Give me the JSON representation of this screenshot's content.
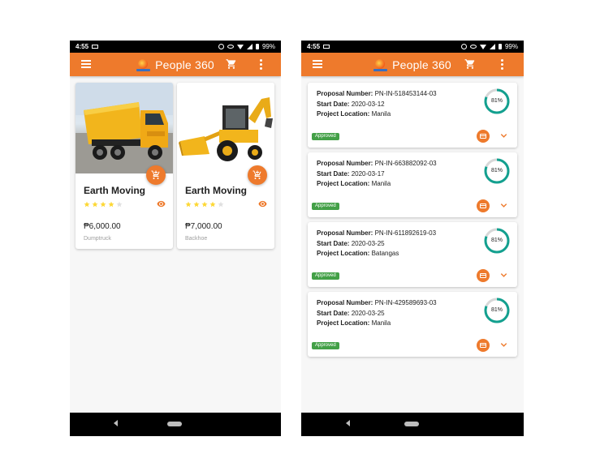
{
  "status_bar": {
    "time": "4:55",
    "battery": "99%"
  },
  "app_bar": {
    "title": "People 360"
  },
  "products": [
    {
      "name": "Earth Moving",
      "price": "₱6,000.00",
      "category": "Dumptruck",
      "rating": 4,
      "image": "dump-truck"
    },
    {
      "name": "Earth Moving",
      "price": "₱7,000.00",
      "category": "Backhoe",
      "rating": 4,
      "image": "backhoe-loader"
    }
  ],
  "proposal_labels": {
    "proposal_number": "Proposal Number:",
    "start_date": "Start Date:",
    "project_location": "Project Location:"
  },
  "proposals": [
    {
      "number": "PN-IN-518453144-03",
      "start_date": "2020-03-12",
      "location": "Manila",
      "status": "Approved",
      "progress": "81%",
      "progress_value": 81
    },
    {
      "number": "PN-IN-663882092-03",
      "start_date": "2020-03-17",
      "location": "Manila",
      "status": "Approved",
      "progress": "81%",
      "progress_value": 81
    },
    {
      "number": "PN-IN-611892619-03",
      "start_date": "2020-03-25",
      "location": "Batangas",
      "status": "Approved",
      "progress": "81%",
      "progress_value": 81
    },
    {
      "number": "PN-IN-429589693-03",
      "start_date": "2020-03-25",
      "location": "Manila",
      "status": "Approved",
      "progress": "81%",
      "progress_value": 81
    }
  ],
  "colors": {
    "primary": "#ee7a2c",
    "progress": "#13a08f",
    "progress_track": "#d8d8d8",
    "approved": "#43a047",
    "star": "#fdd835",
    "star_empty": "#e0e0e0"
  },
  "icons": [
    "menu-icon",
    "cart-icon",
    "more-vert-icon",
    "add-cart-icon",
    "eye-icon",
    "document-icon",
    "chevron-down-icon",
    "star-icon"
  ]
}
